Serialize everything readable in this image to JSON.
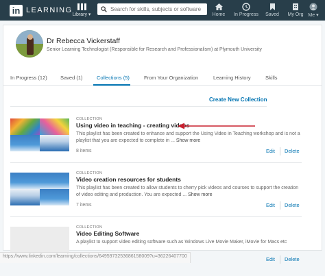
{
  "nav": {
    "brand": "LEARNING",
    "brand_mark": "in",
    "library_label": "Library",
    "search_placeholder": "Search for skills, subjects or software",
    "items": [
      {
        "label": "Home",
        "icon": "home-icon"
      },
      {
        "label": "In Progress",
        "icon": "clock-icon"
      },
      {
        "label": "Saved",
        "icon": "bookmark-icon"
      },
      {
        "label": "My Org",
        "icon": "building-icon"
      },
      {
        "label": "Me",
        "icon": "user-icon"
      }
    ],
    "colors": {
      "bar": "#283e4a",
      "accent": "#0073b1"
    }
  },
  "profile": {
    "name": "Dr Rebecca Vickerstaff",
    "title": "Senior Learning Technologist (Responsible for Research and Professionalism) at Plymouth University"
  },
  "tabs": [
    {
      "label": "In Progress (12)",
      "active": false
    },
    {
      "label": "Saved (1)",
      "active": false
    },
    {
      "label": "Collections (5)",
      "active": true
    },
    {
      "label": "From Your Organization",
      "active": false
    },
    {
      "label": "Learning History",
      "active": false
    },
    {
      "label": "Skills",
      "active": false
    }
  ],
  "create_label": "Create New Collection",
  "collections": [
    {
      "kicker": "COLLECTION",
      "title": "Using video in teaching - creating videos",
      "description": "This playlist has been created to enhance and support the Using Video in Teaching workshop and is not a playlist that you are expected to complete in ...",
      "more": "Show more",
      "count": "8 items",
      "edit": "Edit",
      "delete": "Delete"
    },
    {
      "kicker": "COLLECTION",
      "title": "Video creation resources for students",
      "description": "This playlist has been created to allow students to cherry pick videos and courses to support the creation of video editing and production. You are expected ...",
      "more": "Show more",
      "count": "7 items",
      "edit": "Edit",
      "delete": "Delete"
    },
    {
      "kicker": "COLLECTION",
      "title": "Video Editing Software",
      "description": "A playlist to support video editing software such as Windows Live Movie Maker, iMovie for Macs etc",
      "more": "",
      "count": "",
      "edit": "Edit",
      "delete": "Delete"
    }
  ],
  "status_url": "https://www.linkedin.com/learning/collections/6495973253686158009?u=36226407700"
}
